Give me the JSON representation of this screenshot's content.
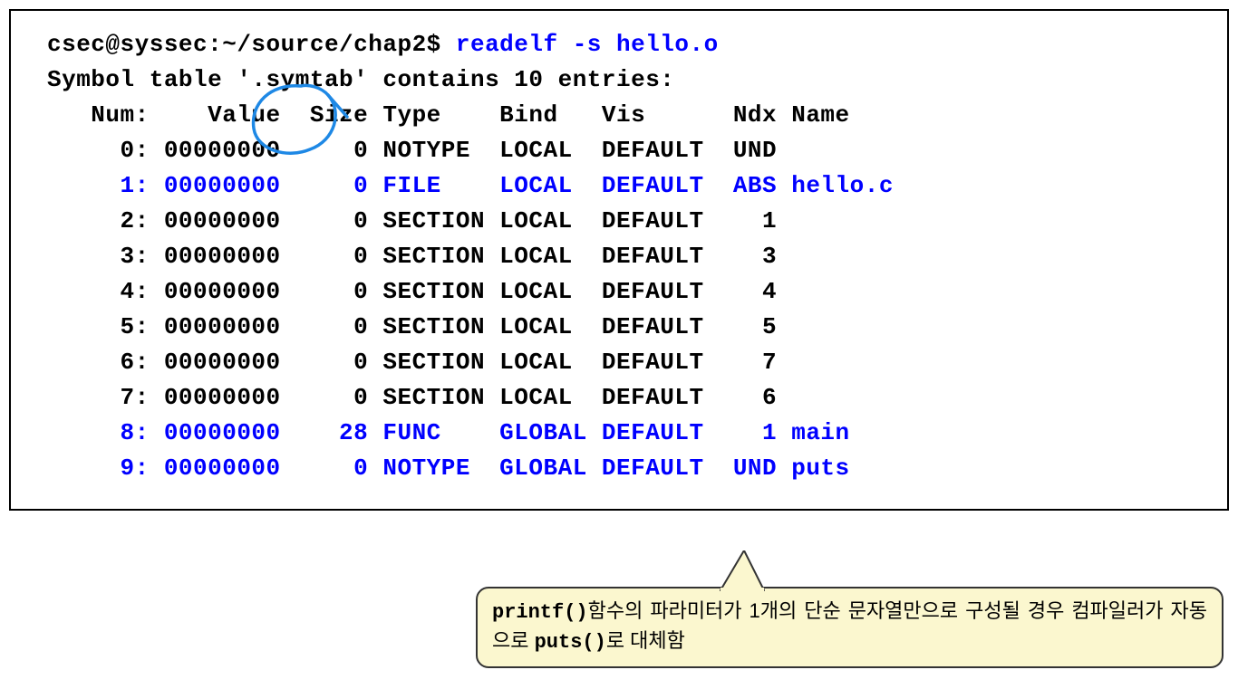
{
  "prompt": "csec@syssec:~/source/chap2$ ",
  "command": "readelf -s hello.o",
  "blank": "",
  "header_prefix": "Symbol table '",
  "header_symtab": ".symtab",
  "header_suffix": "' contains 10 entries:",
  "col_header": "   Num:    Value  Size Type    Bind   Vis      Ndx Name",
  "rows": [
    {
      "text": "     0: 00000000     0 NOTYPE  LOCAL  DEFAULT  UND ",
      "blue": false
    },
    {
      "text": "     1: 00000000     0 FILE    LOCAL  DEFAULT  ABS hello.c",
      "blue": true
    },
    {
      "text": "     2: 00000000     0 SECTION LOCAL  DEFAULT    1 ",
      "blue": false
    },
    {
      "text": "     3: 00000000     0 SECTION LOCAL  DEFAULT    3 ",
      "blue": false
    },
    {
      "text": "     4: 00000000     0 SECTION LOCAL  DEFAULT    4 ",
      "blue": false
    },
    {
      "text": "     5: 00000000     0 SECTION LOCAL  DEFAULT    5 ",
      "blue": false
    },
    {
      "text": "     6: 00000000     0 SECTION LOCAL  DEFAULT    7 ",
      "blue": false
    },
    {
      "text": "     7: 00000000     0 SECTION LOCAL  DEFAULT    6 ",
      "blue": false
    },
    {
      "text": "     8: 00000000    28 FUNC    GLOBAL DEFAULT    1 main",
      "blue": true
    },
    {
      "text": "     9: 00000000     0 NOTYPE  GLOBAL DEFAULT  UND puts",
      "blue": true
    }
  ],
  "callout_mono1": "printf()",
  "callout_text1": "함수의 파라미터가 1개의 단순 문자열만으로 구성될 경우 컴파일러가 자동으로 ",
  "callout_mono2": "puts()",
  "callout_text2": "로 대체함"
}
